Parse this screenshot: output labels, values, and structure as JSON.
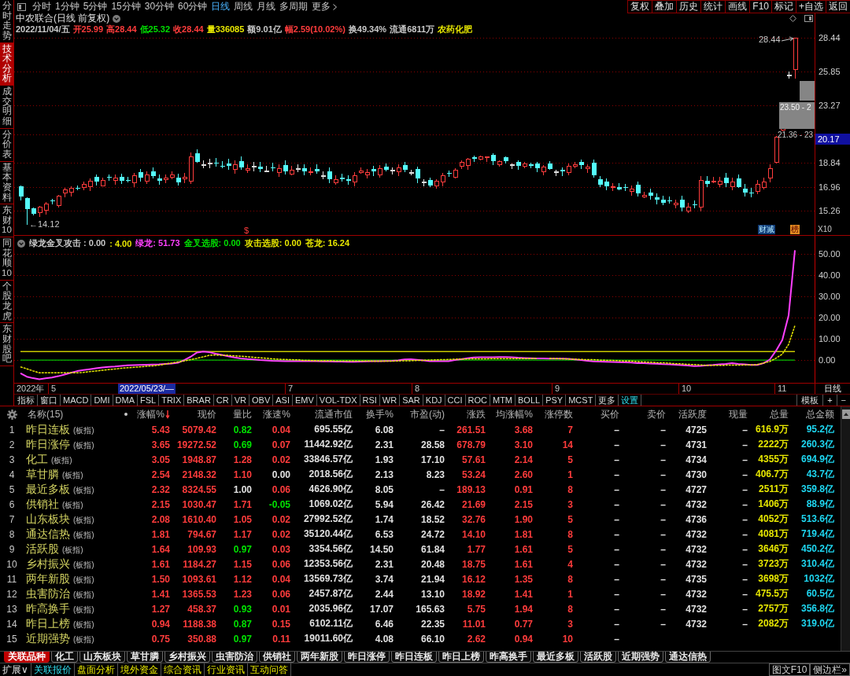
{
  "side_tabs": [
    {
      "label": "分时走势",
      "selected": false
    },
    {
      "label": "技术分析",
      "selected": true
    },
    {
      "label": "成交明细",
      "selected": false
    },
    {
      "label": "分价表",
      "selected": false
    },
    {
      "label": "基本资料",
      "selected": false
    },
    {
      "label": "东财10",
      "selected": false
    },
    {
      "label": "同花顺10",
      "selected": false
    },
    {
      "label": "个股龙虎",
      "selected": false
    },
    {
      "label": "东财股吧",
      "selected": false
    }
  ],
  "toolbar": {
    "periods": [
      {
        "label": "分时",
        "kind": "period",
        "selected": false
      },
      {
        "label": "1分钟",
        "kind": "period",
        "selected": false
      },
      {
        "label": "5分钟",
        "kind": "period",
        "selected": false
      },
      {
        "label": "15分钟",
        "kind": "period",
        "selected": false
      },
      {
        "label": "30分钟",
        "kind": "period",
        "selected": false
      },
      {
        "label": "60分钟",
        "kind": "period",
        "selected": false
      },
      {
        "label": "日线",
        "kind": "period",
        "selected": true
      },
      {
        "label": "周线",
        "kind": "period",
        "selected": false
      },
      {
        "label": "月线",
        "kind": "period",
        "selected": false
      },
      {
        "label": "多周期",
        "kind": "period",
        "selected": false
      },
      {
        "label": "更多",
        "kind": "menu",
        "selected": false
      }
    ],
    "actions": [
      "复权",
      "叠加",
      "历史",
      "统计",
      "画线",
      "F10",
      "标记",
      "+自选",
      "返回"
    ]
  },
  "stock": {
    "title": "中农联合(日线 前复权)",
    "quote": [
      {
        "text": "2022/11/04/五",
        "color": "#c8c8c8"
      },
      {
        "text": "开25.99",
        "color": "#ff3c3c"
      },
      {
        "text": "高28.44",
        "color": "#ff3c3c"
      },
      {
        "text": "低25.32",
        "color": "#00e000"
      },
      {
        "text": "收28.44",
        "color": "#ff3c3c"
      },
      {
        "text": "量336085",
        "color": "#e6e600"
      },
      {
        "text": "额9.01亿",
        "color": "#c8c8c8"
      },
      {
        "text": "幅2.59(10.02%)",
        "color": "#ff3c3c"
      },
      {
        "text": "换49.34%",
        "color": "#c8c8c8"
      },
      {
        "text": "流通6811万",
        "color": "#c8c8c8"
      },
      {
        "text": "农药化肥",
        "color": "#e6e600"
      }
    ]
  },
  "price_chart": {
    "axis_labels": [
      "28.44",
      "25.85",
      "23.27",
      "18.84",
      "16.96",
      "15.26"
    ],
    "current_price": "20.17",
    "high_label": "28.44",
    "low_label": "←14.12",
    "gaps": [
      {
        "label": "23.50 - 2"
      },
      {
        "label": "21.36 - 23"
      }
    ],
    "signal_mark": "$",
    "badges": [
      {
        "text": "财减",
        "kind": "finance"
      },
      {
        "text": "榜",
        "kind": "list"
      }
    ],
    "zoom_label": "X10"
  },
  "indicator": {
    "legend": [
      {
        "text": "绿龙金叉攻击 : 0.00",
        "color": "#c8c8c8"
      },
      {
        "text": ": 4.00",
        "color": "#e6e600"
      },
      {
        "text": "绿龙: 51.73",
        "color": "#ff40ff"
      },
      {
        "text": "金叉选股: 0.00",
        "color": "#00e000"
      },
      {
        "text": "攻击选股: 0.00",
        "color": "#e6e600"
      },
      {
        "text": "苍龙: 16.24",
        "color": "#e6e600"
      }
    ],
    "chart_data": {
      "type": "line",
      "grid": true,
      "ylim": [
        -10.7,
        58.5
      ],
      "yticks": [
        {
          "value": 50,
          "label": "50.00"
        },
        {
          "value": 40,
          "label": "40.00"
        },
        {
          "value": 30,
          "label": "30.00"
        },
        {
          "value": 20,
          "label": "20.00"
        },
        {
          "value": 10,
          "label": "10.00"
        },
        {
          "value": 0,
          "label": "0.00"
        }
      ],
      "series": [
        {
          "color": "#ff40ff",
          "line_style": "solid",
          "values": [
            -6.2,
            -7.8,
            -8.5,
            -9.0,
            -8.6,
            -8.2,
            -7.6,
            -6.8,
            -6.0,
            -5.2,
            -4.7,
            -4.3,
            -3.9,
            -3.5,
            -3.2,
            -3.0,
            -2.7,
            -2.5,
            -2.4,
            -2.3,
            -2.2,
            -2.1,
            -2.0,
            -1.8,
            -1.6,
            -1.3,
            0.0,
            1.5,
            3.5,
            4.0,
            3.7,
            3.0,
            2.4,
            1.8,
            1.2,
            0.8,
            0.5,
            0.3,
            0.0,
            -0.1,
            -0.3,
            -0.4,
            -0.5,
            -0.5,
            -0.5,
            -0.5,
            -0.5,
            -0.5,
            -0.6,
            -0.6,
            -0.7,
            -0.7,
            -0.8,
            -0.8,
            -0.7,
            -0.6,
            -0.5,
            -0.5,
            -0.4,
            -0.3,
            -0.1,
            0.3,
            0.4,
            0.1,
            -0.2,
            -0.5,
            -0.5,
            -0.5,
            -0.5,
            0.0,
            0.4,
            0.9,
            1.2,
            1.3,
            1.3,
            1.3,
            1.4,
            1.4,
            1.3,
            1.1,
            1.0,
            0.9,
            0.8,
            0.8,
            0.7,
            0.7,
            0.7,
            0.6,
            0.3,
            0.0,
            -0.3,
            -0.6,
            -0.7,
            -0.8,
            -0.9,
            -1.0,
            -1.1,
            -1.2,
            -1.4,
            -1.5,
            -1.6,
            -1.7,
            -1.9,
            -2.0,
            -2.2,
            -2.4,
            -2.6,
            -2.8,
            -2.7,
            -2.5,
            -2.3,
            -2.0,
            -1.8,
            -1.5,
            -1.8,
            -2.0,
            -2.3,
            -2.3,
            -1.5,
            0.2,
            4.4,
            9.5,
            21.0,
            51.7
          ]
        },
        {
          "color": "#e6e600",
          "line_style": "dashed",
          "values": [
            -3.2,
            -4.1,
            -5.1,
            -6.0,
            -6.0,
            -6.0,
            -6.0,
            -6.0,
            -6.0,
            -6.0,
            -5.8,
            -5.4,
            -5.1,
            -4.8,
            -4.5,
            -4.2,
            -3.9,
            -3.6,
            -3.4,
            -3.2,
            -2.9,
            -2.7,
            -2.4,
            -1.9,
            -1.4,
            -0.9,
            -0.4,
            0.2,
            0.8,
            1.5,
            2.2,
            2.4,
            2.3,
            2.2,
            2.0,
            1.8,
            1.6,
            1.3,
            1.1,
            0.9,
            0.6,
            0.4,
            0.3,
            0.2,
            0.1,
            -0.1,
            -0.2,
            -0.3,
            -0.3,
            -0.3,
            -0.4,
            -0.4,
            -0.4,
            -0.4,
            -0.4,
            -0.4,
            -0.5,
            -0.5,
            -0.5,
            -0.5,
            -0.4,
            -0.3,
            -0.3,
            -0.2,
            -0.1,
            0.0,
            0.1,
            0.2,
            0.3,
            0.4,
            0.5,
            0.5,
            0.6,
            0.6,
            0.6,
            0.7,
            0.7,
            0.7,
            0.7,
            0.7,
            0.7,
            0.7,
            0.8,
            null,
            0.8,
            0.7,
            0.6,
            0.5,
            0.4,
            0.3,
            0.2,
            0.2,
            0.0,
            -0.1,
            -0.2,
            -0.3,
            -0.4,
            -0.5,
            -0.7,
            -0.9,
            -1.0,
            -1.2,
            -1.3,
            -1.5,
            -1.7,
            -1.8,
            -2.0,
            -2.1,
            -2.3,
            -2.5,
            -2.5,
            -2.5,
            -2.4,
            -2.4,
            -2.4,
            -2.3,
            -2.3,
            -2.1,
            -1.4,
            -0.7,
            0.9,
            2.8,
            7.4,
            16.2
          ]
        }
      ],
      "ref_lines": [
        {
          "axis": "y",
          "value": 4,
          "color": "#c8c800"
        },
        {
          "axis": "y",
          "value": 0,
          "color": "#00c000"
        }
      ]
    }
  },
  "time_axis": {
    "labels": [
      {
        "text": "2022年",
        "kind": "year"
      },
      {
        "text": "5",
        "kind": "month"
      },
      {
        "text": "2022/05/23/—",
        "kind": "cursor"
      },
      {
        "text": "7",
        "kind": "month"
      },
      {
        "text": "8",
        "kind": "month"
      },
      {
        "text": "9",
        "kind": "month"
      },
      {
        "text": "10",
        "kind": "month"
      },
      {
        "text": "11",
        "kind": "month"
      }
    ],
    "period": "日线"
  },
  "indicator_tabs": [
    {
      "label": "指标",
      "kind": "tab"
    },
    {
      "label": "窗口",
      "kind": "tab"
    },
    {
      "label": "MACD",
      "kind": "tab"
    },
    {
      "label": "DMI",
      "kind": "tab"
    },
    {
      "label": "DMA",
      "kind": "tab"
    },
    {
      "label": "FSL",
      "kind": "tab"
    },
    {
      "label": "TRIX",
      "kind": "tab"
    },
    {
      "label": "BRAR",
      "kind": "tab"
    },
    {
      "label": "CR",
      "kind": "tab"
    },
    {
      "label": "VR",
      "kind": "tab"
    },
    {
      "label": "OBV",
      "kind": "tab"
    },
    {
      "label": "ASI",
      "kind": "tab"
    },
    {
      "label": "EMV",
      "kind": "tab"
    },
    {
      "label": "VOL-TDX",
      "kind": "tab"
    },
    {
      "label": "RSI",
      "kind": "tab"
    },
    {
      "label": "WR",
      "kind": "tab"
    },
    {
      "label": "SAR",
      "kind": "tab"
    },
    {
      "label": "KDJ",
      "kind": "tab"
    },
    {
      "label": "CCI",
      "kind": "tab"
    },
    {
      "label": "ROC",
      "kind": "tab"
    },
    {
      "label": "MTM",
      "kind": "tab"
    },
    {
      "label": "BOLL",
      "kind": "tab"
    },
    {
      "label": "PSY",
      "kind": "tab"
    },
    {
      "label": "MCST",
      "kind": "tab"
    },
    {
      "label": "更多",
      "kind": "tab"
    },
    {
      "label": "设置",
      "kind": "settings"
    }
  ],
  "indicator_tools": [
    "模板",
    "+",
    "−"
  ],
  "table": {
    "columns": [
      {
        "label": "名称(15)",
        "kind": "name",
        "sorted": false
      },
      {
        "label": "涨幅%",
        "kind": "trend",
        "sorted": true
      },
      {
        "label": "现价",
        "kind": "trend",
        "sorted": false
      },
      {
        "label": "量比",
        "kind": "trend",
        "sorted": false
      },
      {
        "label": "涨速%",
        "kind": "trend",
        "sorted": false
      },
      {
        "label": "流通市值",
        "kind": "plain",
        "sorted": false
      },
      {
        "label": "换手%",
        "kind": "plain",
        "sorted": false
      },
      {
        "label": "市盈(动)",
        "kind": "plain",
        "sorted": false
      },
      {
        "label": "涨跌",
        "kind": "trend",
        "sorted": false
      },
      {
        "label": "均涨幅%",
        "kind": "trend",
        "sorted": false
      },
      {
        "label": "涨停数",
        "kind": "trend",
        "sorted": false
      },
      {
        "label": "买价",
        "kind": "plain",
        "sorted": false
      },
      {
        "label": "卖价",
        "kind": "plain",
        "sorted": false
      },
      {
        "label": "活跃度",
        "kind": "plain",
        "sorted": false
      },
      {
        "label": "现量",
        "kind": "plain",
        "sorted": false
      },
      {
        "label": "总量",
        "kind": "volume",
        "sorted": false
      },
      {
        "label": "总金额",
        "kind": "amount",
        "sorted": false
      }
    ],
    "rows": [
      {
        "number": "1",
        "cells": [
          {
            "text": "昨日连板",
            "tag": "(板指)"
          },
          {
            "text": "5.43",
            "color": "#ff3c3c"
          },
          {
            "text": "5079.42",
            "color": "#ff3c3c"
          },
          {
            "text": "0.82",
            "color": "#00e000"
          },
          {
            "text": "0.04",
            "color": "#ff3c3c"
          },
          {
            "text": "695.55亿"
          },
          {
            "text": "6.08"
          },
          {
            "text": "–"
          },
          {
            "text": "261.51",
            "color": "#ff3c3c"
          },
          {
            "text": "3.68",
            "color": "#ff3c3c"
          },
          {
            "text": "7",
            "color": "#ff3c3c"
          },
          {
            "text": "–"
          },
          {
            "text": "–"
          },
          {
            "text": "4725"
          },
          {
            "text": "–"
          },
          {
            "text": "616.9万"
          },
          {
            "text": "95.2亿"
          }
        ]
      },
      {
        "number": "2",
        "cells": [
          {
            "text": "昨日涨停",
            "tag": "(板指)"
          },
          {
            "text": "3.65",
            "color": "#ff3c3c"
          },
          {
            "text": "19272.52",
            "color": "#ff3c3c"
          },
          {
            "text": "0.69",
            "color": "#00e000"
          },
          {
            "text": "0.07",
            "color": "#ff3c3c"
          },
          {
            "text": "11442.92亿"
          },
          {
            "text": "2.31"
          },
          {
            "text": "28.58"
          },
          {
            "text": "678.79",
            "color": "#ff3c3c"
          },
          {
            "text": "3.10",
            "color": "#ff3c3c"
          },
          {
            "text": "14",
            "color": "#ff3c3c"
          },
          {
            "text": "–"
          },
          {
            "text": "–"
          },
          {
            "text": "4731"
          },
          {
            "text": "–"
          },
          {
            "text": "2222万"
          },
          {
            "text": "260.3亿"
          }
        ]
      },
      {
        "number": "3",
        "cells": [
          {
            "text": "化工",
            "tag": "(板指)"
          },
          {
            "text": "3.05",
            "color": "#ff3c3c"
          },
          {
            "text": "1948.87",
            "color": "#ff3c3c"
          },
          {
            "text": "1.28",
            "color": "#ff3c3c"
          },
          {
            "text": "0.02",
            "color": "#ff3c3c"
          },
          {
            "text": "33846.57亿"
          },
          {
            "text": "1.93"
          },
          {
            "text": "17.10"
          },
          {
            "text": "57.61",
            "color": "#ff3c3c"
          },
          {
            "text": "2.14",
            "color": "#ff3c3c"
          },
          {
            "text": "5",
            "color": "#ff3c3c"
          },
          {
            "text": "–"
          },
          {
            "text": "–"
          },
          {
            "text": "4734"
          },
          {
            "text": "–"
          },
          {
            "text": "4355万"
          },
          {
            "text": "694.9亿"
          }
        ]
      },
      {
        "number": "4",
        "cells": [
          {
            "text": "草甘膦",
            "tag": "(板指)"
          },
          {
            "text": "2.54",
            "color": "#ff3c3c"
          },
          {
            "text": "2148.32",
            "color": "#ff3c3c"
          },
          {
            "text": "1.10",
            "color": "#ff3c3c"
          },
          {
            "text": "0.00",
            "color": "#e0e0e0"
          },
          {
            "text": "2018.56亿"
          },
          {
            "text": "2.13"
          },
          {
            "text": "8.23"
          },
          {
            "text": "53.24",
            "color": "#ff3c3c"
          },
          {
            "text": "2.60",
            "color": "#ff3c3c"
          },
          {
            "text": "1",
            "color": "#ff3c3c"
          },
          {
            "text": "–"
          },
          {
            "text": "–"
          },
          {
            "text": "4730"
          },
          {
            "text": "–"
          },
          {
            "text": "406.7万"
          },
          {
            "text": "43.7亿"
          }
        ]
      },
      {
        "number": "5",
        "cells": [
          {
            "text": "最近多板",
            "tag": "(板指)"
          },
          {
            "text": "2.32",
            "color": "#ff3c3c"
          },
          {
            "text": "8324.55",
            "color": "#ff3c3c"
          },
          {
            "text": "1.00",
            "color": "#e0e0e0"
          },
          {
            "text": "0.06",
            "color": "#ff3c3c"
          },
          {
            "text": "4626.90亿"
          },
          {
            "text": "8.05"
          },
          {
            "text": "–"
          },
          {
            "text": "189.13",
            "color": "#ff3c3c"
          },
          {
            "text": "0.91",
            "color": "#ff3c3c"
          },
          {
            "text": "8",
            "color": "#ff3c3c"
          },
          {
            "text": "–"
          },
          {
            "text": "–"
          },
          {
            "text": "4727"
          },
          {
            "text": "–"
          },
          {
            "text": "2511万"
          },
          {
            "text": "359.8亿"
          }
        ]
      },
      {
        "number": "6",
        "cells": [
          {
            "text": "供销社",
            "tag": "(板指)"
          },
          {
            "text": "2.15",
            "color": "#ff3c3c"
          },
          {
            "text": "1030.47",
            "color": "#ff3c3c"
          },
          {
            "text": "1.71",
            "color": "#ff3c3c"
          },
          {
            "text": "-0.05",
            "color": "#00e000"
          },
          {
            "text": "1069.02亿"
          },
          {
            "text": "5.94"
          },
          {
            "text": "26.42"
          },
          {
            "text": "21.69",
            "color": "#ff3c3c"
          },
          {
            "text": "2.15",
            "color": "#ff3c3c"
          },
          {
            "text": "3",
            "color": "#ff3c3c"
          },
          {
            "text": "–"
          },
          {
            "text": "–"
          },
          {
            "text": "4732"
          },
          {
            "text": "–"
          },
          {
            "text": "1406万"
          },
          {
            "text": "88.9亿"
          }
        ]
      },
      {
        "number": "7",
        "cells": [
          {
            "text": "山东板块",
            "tag": "(板指)"
          },
          {
            "text": "2.08",
            "color": "#ff3c3c"
          },
          {
            "text": "1610.40",
            "color": "#ff3c3c"
          },
          {
            "text": "1.05",
            "color": "#ff3c3c"
          },
          {
            "text": "0.02",
            "color": "#ff3c3c"
          },
          {
            "text": "27992.52亿"
          },
          {
            "text": "1.74"
          },
          {
            "text": "18.52"
          },
          {
            "text": "32.76",
            "color": "#ff3c3c"
          },
          {
            "text": "1.90",
            "color": "#ff3c3c"
          },
          {
            "text": "5",
            "color": "#ff3c3c"
          },
          {
            "text": "–"
          },
          {
            "text": "–"
          },
          {
            "text": "4736"
          },
          {
            "text": "–"
          },
          {
            "text": "4052万"
          },
          {
            "text": "513.6亿"
          }
        ]
      },
      {
        "number": "8",
        "cells": [
          {
            "text": "通达信热",
            "tag": "(板指)"
          },
          {
            "text": "1.81",
            "color": "#ff3c3c"
          },
          {
            "text": "794.67",
            "color": "#ff3c3c"
          },
          {
            "text": "1.17",
            "color": "#ff3c3c"
          },
          {
            "text": "0.02",
            "color": "#ff3c3c"
          },
          {
            "text": "35120.44亿"
          },
          {
            "text": "6.53"
          },
          {
            "text": "24.72"
          },
          {
            "text": "14.10",
            "color": "#ff3c3c"
          },
          {
            "text": "1.81",
            "color": "#ff3c3c"
          },
          {
            "text": "8",
            "color": "#ff3c3c"
          },
          {
            "text": "–"
          },
          {
            "text": "–"
          },
          {
            "text": "4732"
          },
          {
            "text": "–"
          },
          {
            "text": "4081万"
          },
          {
            "text": "719.4亿"
          }
        ]
      },
      {
        "number": "9",
        "cells": [
          {
            "text": "活跃股",
            "tag": "(板指)"
          },
          {
            "text": "1.64",
            "color": "#ff3c3c"
          },
          {
            "text": "109.93",
            "color": "#ff3c3c"
          },
          {
            "text": "0.97",
            "color": "#00e000"
          },
          {
            "text": "0.03",
            "color": "#ff3c3c"
          },
          {
            "text": "3354.56亿"
          },
          {
            "text": "14.50"
          },
          {
            "text": "61.84"
          },
          {
            "text": "1.77",
            "color": "#ff3c3c"
          },
          {
            "text": "1.61",
            "color": "#ff3c3c"
          },
          {
            "text": "5",
            "color": "#ff3c3c"
          },
          {
            "text": "–"
          },
          {
            "text": "–"
          },
          {
            "text": "4732"
          },
          {
            "text": "–"
          },
          {
            "text": "3646万"
          },
          {
            "text": "450.2亿"
          }
        ]
      },
      {
        "number": "10",
        "cells": [
          {
            "text": "乡村振兴",
            "tag": "(板指)"
          },
          {
            "text": "1.61",
            "color": "#ff3c3c"
          },
          {
            "text": "1184.27",
            "color": "#ff3c3c"
          },
          {
            "text": "1.15",
            "color": "#ff3c3c"
          },
          {
            "text": "0.06",
            "color": "#ff3c3c"
          },
          {
            "text": "12353.56亿"
          },
          {
            "text": "2.31"
          },
          {
            "text": "20.48"
          },
          {
            "text": "18.75",
            "color": "#ff3c3c"
          },
          {
            "text": "1.61",
            "color": "#ff3c3c"
          },
          {
            "text": "4",
            "color": "#ff3c3c"
          },
          {
            "text": "–"
          },
          {
            "text": "–"
          },
          {
            "text": "4732"
          },
          {
            "text": "–"
          },
          {
            "text": "3723万"
          },
          {
            "text": "310.4亿"
          }
        ]
      },
      {
        "number": "11",
        "cells": [
          {
            "text": "两年新股",
            "tag": "(板指)"
          },
          {
            "text": "1.50",
            "color": "#ff3c3c"
          },
          {
            "text": "1093.61",
            "color": "#ff3c3c"
          },
          {
            "text": "1.12",
            "color": "#ff3c3c"
          },
          {
            "text": "0.04",
            "color": "#ff3c3c"
          },
          {
            "text": "13569.73亿"
          },
          {
            "text": "3.74"
          },
          {
            "text": "21.94"
          },
          {
            "text": "16.12",
            "color": "#ff3c3c"
          },
          {
            "text": "1.35",
            "color": "#ff3c3c"
          },
          {
            "text": "8",
            "color": "#ff3c3c"
          },
          {
            "text": "–"
          },
          {
            "text": "–"
          },
          {
            "text": "4735"
          },
          {
            "text": "–"
          },
          {
            "text": "3698万"
          },
          {
            "text": "1032亿"
          }
        ]
      },
      {
        "number": "12",
        "cells": [
          {
            "text": "虫害防治",
            "tag": "(板指)"
          },
          {
            "text": "1.41",
            "color": "#ff3c3c"
          },
          {
            "text": "1365.53",
            "color": "#ff3c3c"
          },
          {
            "text": "1.23",
            "color": "#ff3c3c"
          },
          {
            "text": "0.06",
            "color": "#ff3c3c"
          },
          {
            "text": "2457.87亿"
          },
          {
            "text": "2.44"
          },
          {
            "text": "13.10"
          },
          {
            "text": "18.92",
            "color": "#ff3c3c"
          },
          {
            "text": "1.41",
            "color": "#ff3c3c"
          },
          {
            "text": "1",
            "color": "#ff3c3c"
          },
          {
            "text": "–"
          },
          {
            "text": "–"
          },
          {
            "text": "4732"
          },
          {
            "text": "–"
          },
          {
            "text": "475.5万"
          },
          {
            "text": "60.5亿"
          }
        ]
      },
      {
        "number": "13",
        "cells": [
          {
            "text": "昨高换手",
            "tag": "(板指)"
          },
          {
            "text": "1.27",
            "color": "#ff3c3c"
          },
          {
            "text": "458.37",
            "color": "#ff3c3c"
          },
          {
            "text": "0.93",
            "color": "#00e000"
          },
          {
            "text": "0.01",
            "color": "#ff3c3c"
          },
          {
            "text": "2035.96亿"
          },
          {
            "text": "17.07"
          },
          {
            "text": "165.63"
          },
          {
            "text": "5.75",
            "color": "#ff3c3c"
          },
          {
            "text": "1.94",
            "color": "#ff3c3c"
          },
          {
            "text": "8",
            "color": "#ff3c3c"
          },
          {
            "text": "–"
          },
          {
            "text": "–"
          },
          {
            "text": "4732"
          },
          {
            "text": "–"
          },
          {
            "text": "2757万"
          },
          {
            "text": "356.8亿"
          }
        ]
      },
      {
        "number": "14",
        "cells": [
          {
            "text": "昨日上榜",
            "tag": "(板指)"
          },
          {
            "text": "0.94",
            "color": "#ff3c3c"
          },
          {
            "text": "1188.38",
            "color": "#ff3c3c"
          },
          {
            "text": "0.87",
            "color": "#00e000"
          },
          {
            "text": "0.15",
            "color": "#ff3c3c"
          },
          {
            "text": "6102.11亿"
          },
          {
            "text": "6.46"
          },
          {
            "text": "22.35"
          },
          {
            "text": "11.01",
            "color": "#ff3c3c"
          },
          {
            "text": "0.77",
            "color": "#ff3c3c"
          },
          {
            "text": "3",
            "color": "#ff3c3c"
          },
          {
            "text": "–"
          },
          {
            "text": "–"
          },
          {
            "text": "4732"
          },
          {
            "text": "–"
          },
          {
            "text": "2082万"
          },
          {
            "text": "319.0亿"
          }
        ]
      },
      {
        "number": "15",
        "cells": [
          {
            "text": "近期强势",
            "tag": "(板指)"
          },
          {
            "text": "0.75",
            "color": "#ff3c3c"
          },
          {
            "text": "350.88",
            "color": "#ff3c3c"
          },
          {
            "text": "0.97",
            "color": "#00e000"
          },
          {
            "text": "0.11",
            "color": "#ff3c3c"
          },
          {
            "text": "19011.60亿"
          },
          {
            "text": "4.08"
          },
          {
            "text": "66.10"
          },
          {
            "text": "2.62",
            "color": "#ff3c3c"
          },
          {
            "text": "0.94",
            "color": "#ff3c3c"
          },
          {
            "text": "10",
            "color": "#ff3c3c"
          },
          {
            "text": "–"
          }
        ]
      }
    ]
  },
  "related_tabs": [
    {
      "label": "关联品种",
      "selected": true
    },
    {
      "label": "化工",
      "selected": false
    },
    {
      "label": "山东板块",
      "selected": false
    },
    {
      "label": "草甘膦",
      "selected": false
    },
    {
      "label": "乡村振兴",
      "selected": false
    },
    {
      "label": "虫害防治",
      "selected": false
    },
    {
      "label": "供销社",
      "selected": false
    },
    {
      "label": "两年新股",
      "selected": false
    },
    {
      "label": "昨日涨停",
      "selected": false
    },
    {
      "label": "昨日连板",
      "selected": false
    },
    {
      "label": "昨日上榜",
      "selected": false
    },
    {
      "label": "昨高换手",
      "selected": false
    },
    {
      "label": "最近多板",
      "selected": false
    },
    {
      "label": "活跃股",
      "selected": false
    },
    {
      "label": "近期强势",
      "selected": false
    },
    {
      "label": "通达信热",
      "selected": false
    }
  ],
  "bottom_bar": {
    "expand": "扩展∨",
    "links": [
      {
        "label": "关联报价",
        "selected": true
      },
      {
        "label": "盘面分析",
        "selected": false
      },
      {
        "label": "境外资金",
        "selected": false
      },
      {
        "label": "综合资讯",
        "selected": false
      },
      {
        "label": "行业资讯",
        "selected": false
      },
      {
        "label": "互动问答",
        "selected": false
      }
    ],
    "right": [
      "图文F10",
      "侧边栏»"
    ]
  }
}
